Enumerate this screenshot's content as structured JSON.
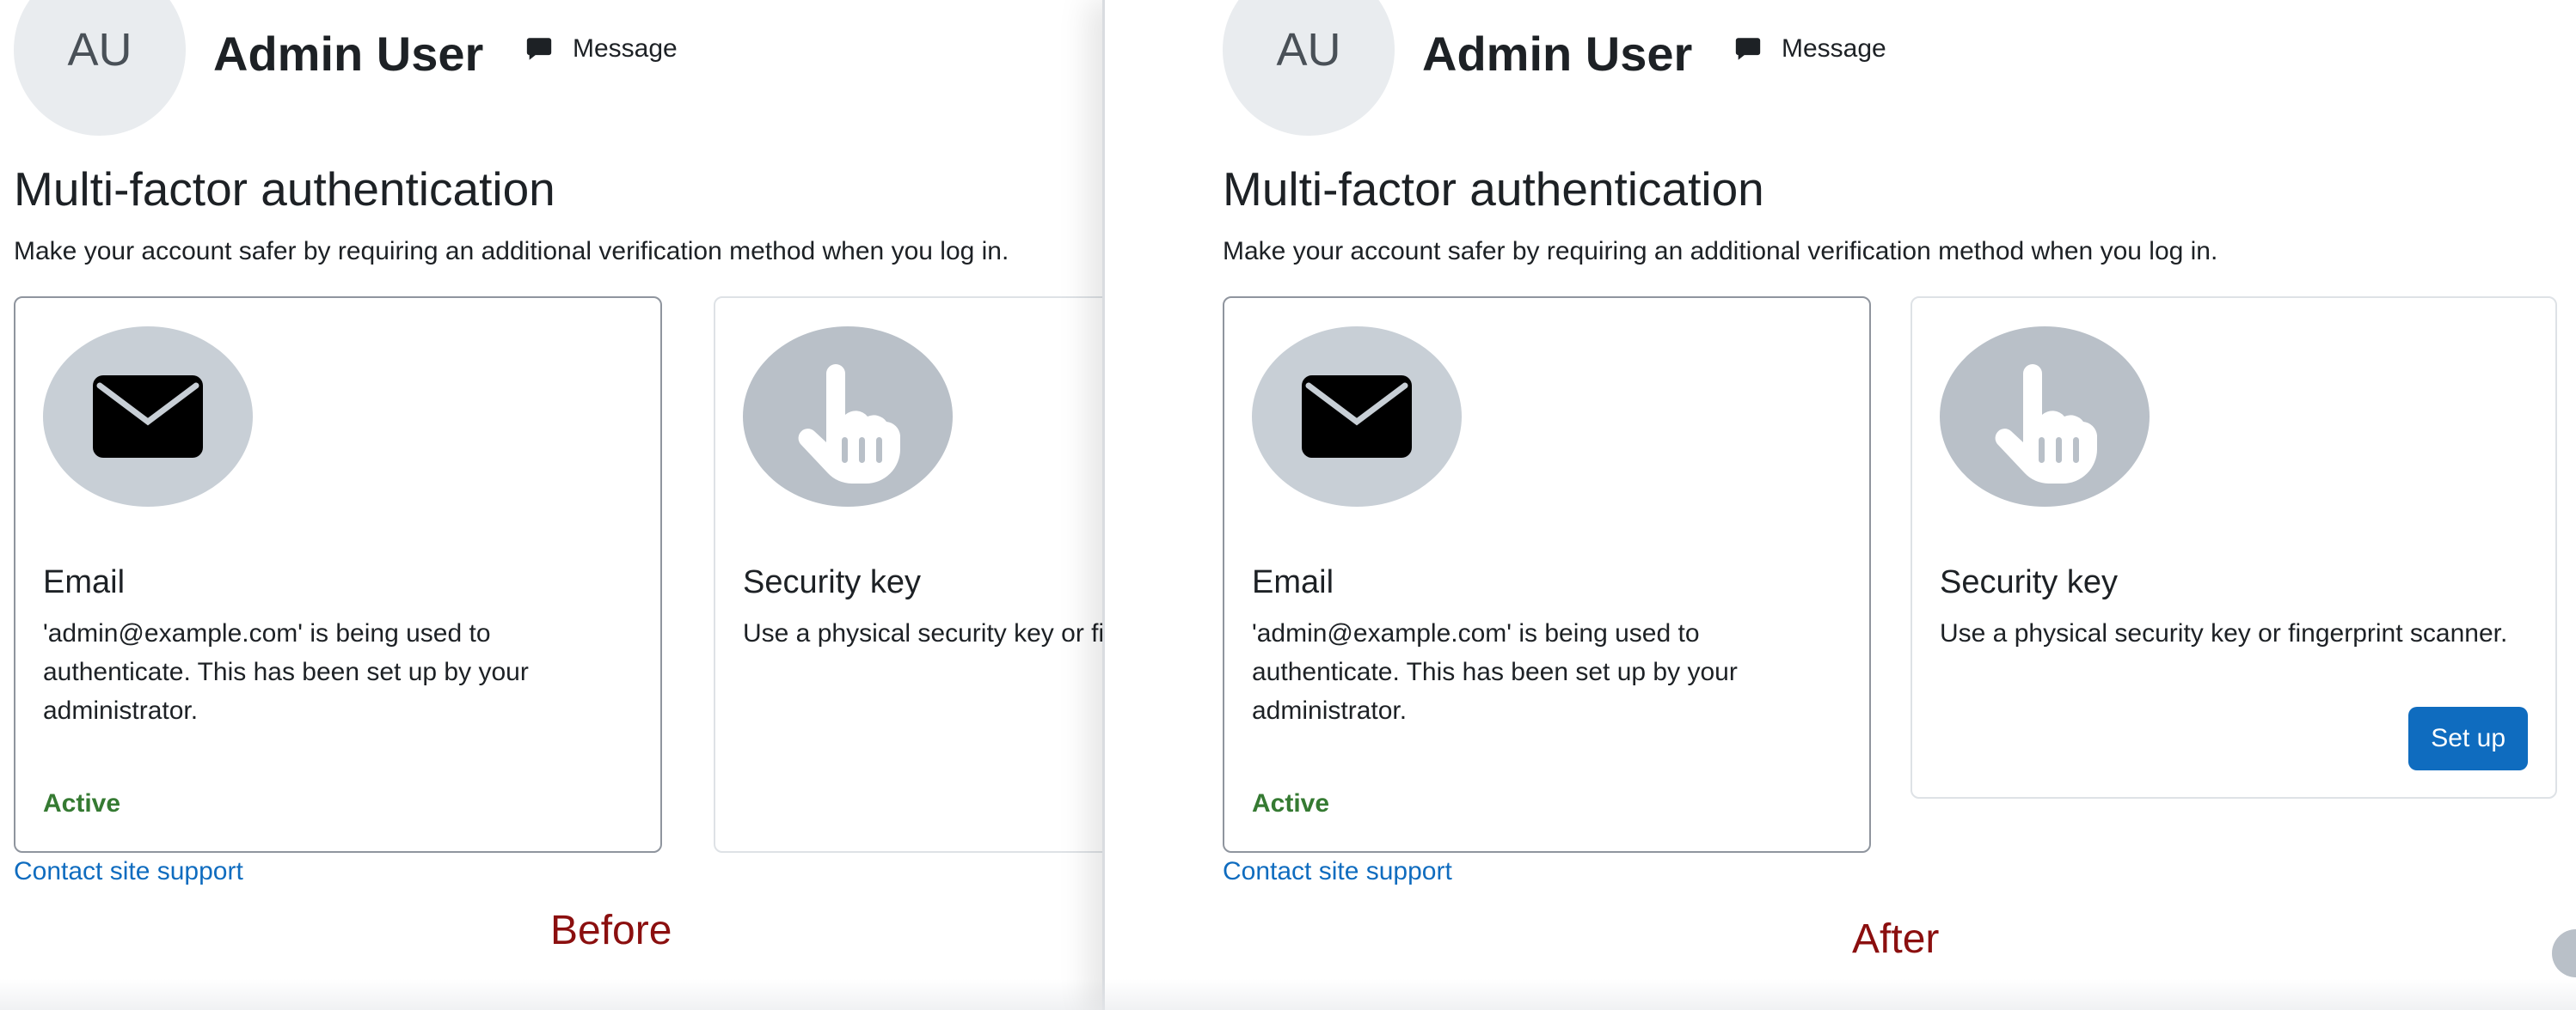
{
  "user": {
    "initials": "AU",
    "name": "Admin User",
    "message_label": "Message"
  },
  "page": {
    "title": "Multi-factor authentication",
    "description": "Make your account safer by requiring an additional verification method when you log in."
  },
  "email_card": {
    "icon": "envelope-icon",
    "title": "Email",
    "text": "'admin@example.com' is being used to authenticate. This has been set up by your administrator.",
    "status": "Active"
  },
  "security_key_card": {
    "icon": "hand-pointer-icon",
    "title": "Security key",
    "text": "Use a physical security key or fingerprint scanner.",
    "setup_label": "Set up"
  },
  "support_link": "Contact site support",
  "labels": {
    "before": "Before",
    "after": "After"
  },
  "colors": {
    "link": "#0f6cbf",
    "primary_button": "#0f6cbf",
    "active_status": "#357a32",
    "label": "#8b0f0f"
  }
}
